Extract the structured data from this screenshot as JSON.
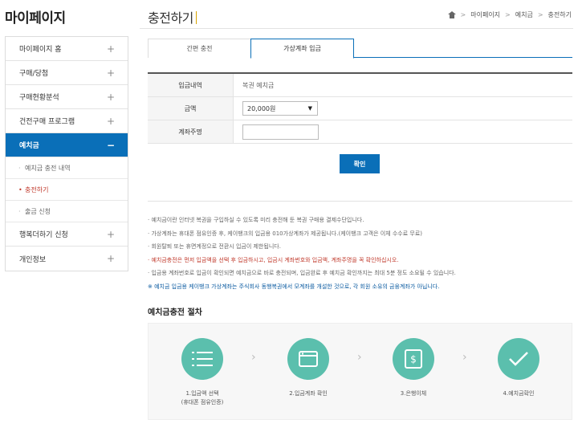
{
  "sidebar": {
    "title": "마이페이지",
    "items": [
      {
        "label": "마이페이지 홈",
        "toggle": "+"
      },
      {
        "label": "구매/당첨",
        "toggle": "+"
      },
      {
        "label": "구매현황분석",
        "toggle": "+"
      },
      {
        "label": "건전구매 프로그램",
        "toggle": "+"
      },
      {
        "label": "예치금",
        "toggle": "−"
      },
      {
        "label": "행복더하기 신청",
        "toggle": "+"
      },
      {
        "label": "개인정보",
        "toggle": "+"
      }
    ],
    "sub_items": [
      {
        "bullet": "·",
        "label": "예치금 충전 내역"
      },
      {
        "bullet": "•",
        "label": "충전하기"
      },
      {
        "bullet": "·",
        "label": "출금 신청"
      }
    ]
  },
  "header": {
    "title": "충전하기",
    "breadcrumb": [
      "마이페이지",
      "예치금",
      "충전하기"
    ],
    "breadcrumb_sep": ">"
  },
  "tabs": [
    "간편 충전",
    "가상계좌 입금"
  ],
  "form": {
    "rows": [
      {
        "label": "입금내역",
        "value": "복권 예치금"
      },
      {
        "label": "금액",
        "value": "20,000원",
        "arrow": "▼"
      },
      {
        "label": "계좌주명",
        "value": ""
      }
    ],
    "confirm_label": "확인"
  },
  "notices": [
    "·  예치금이란 인터넷 복권을 구입하실 수 있도록 미리 충전해 둔 복권 구매용 결제수단입니다.",
    "·  가상계좌는 휴대폰 점유인증 후, 케이뱅크의 입금용 010가상계좌가 제공됩니다.(케이뱅크 고객은 이체 수수료 무료)",
    "·  회원탈퇴 또는 휴면계정으로 전환시 입금이 제한됩니다.",
    "·  예치금충전은 먼저 입금액을 선택 후 입금하시고, 입금시 계좌번호와 입금액, 계좌주명을 꼭 확인하십시오.",
    "·  입금용 계좌번호로 입금이 확인되면 예치금으로 바로 충전되며, 입금완료 후 예치금 확인까지는 최대 5분 정도 소요될 수 있습니다.",
    "※ 예치금 입금용 케이뱅크 가상계좌는 주식회사 동행복권에서 모계좌를 개설한 것으로, 각 회원 소유의 금융계좌가 아닙니다."
  ],
  "procedure": {
    "title": "예치금충전 절차",
    "steps": [
      {
        "icon": "list-icon",
        "caption_1": "1.입금액 선택",
        "caption_2": "(휴대폰 점유인증)"
      },
      {
        "icon": "account-icon",
        "caption_1": "2.입금계좌 확인",
        "caption_2": ""
      },
      {
        "icon": "bank-transfer-icon",
        "caption_1": "3.은행이체",
        "caption_2": ""
      },
      {
        "icon": "check-icon",
        "caption_1": "4.예치금확인",
        "caption_2": ""
      }
    ],
    "chevron": "›"
  },
  "colors": {
    "accent": "#0a6fb8",
    "step_circle": "#5bbfad",
    "warning_text": "#c0392b",
    "info_text": "#0a5aa0"
  }
}
